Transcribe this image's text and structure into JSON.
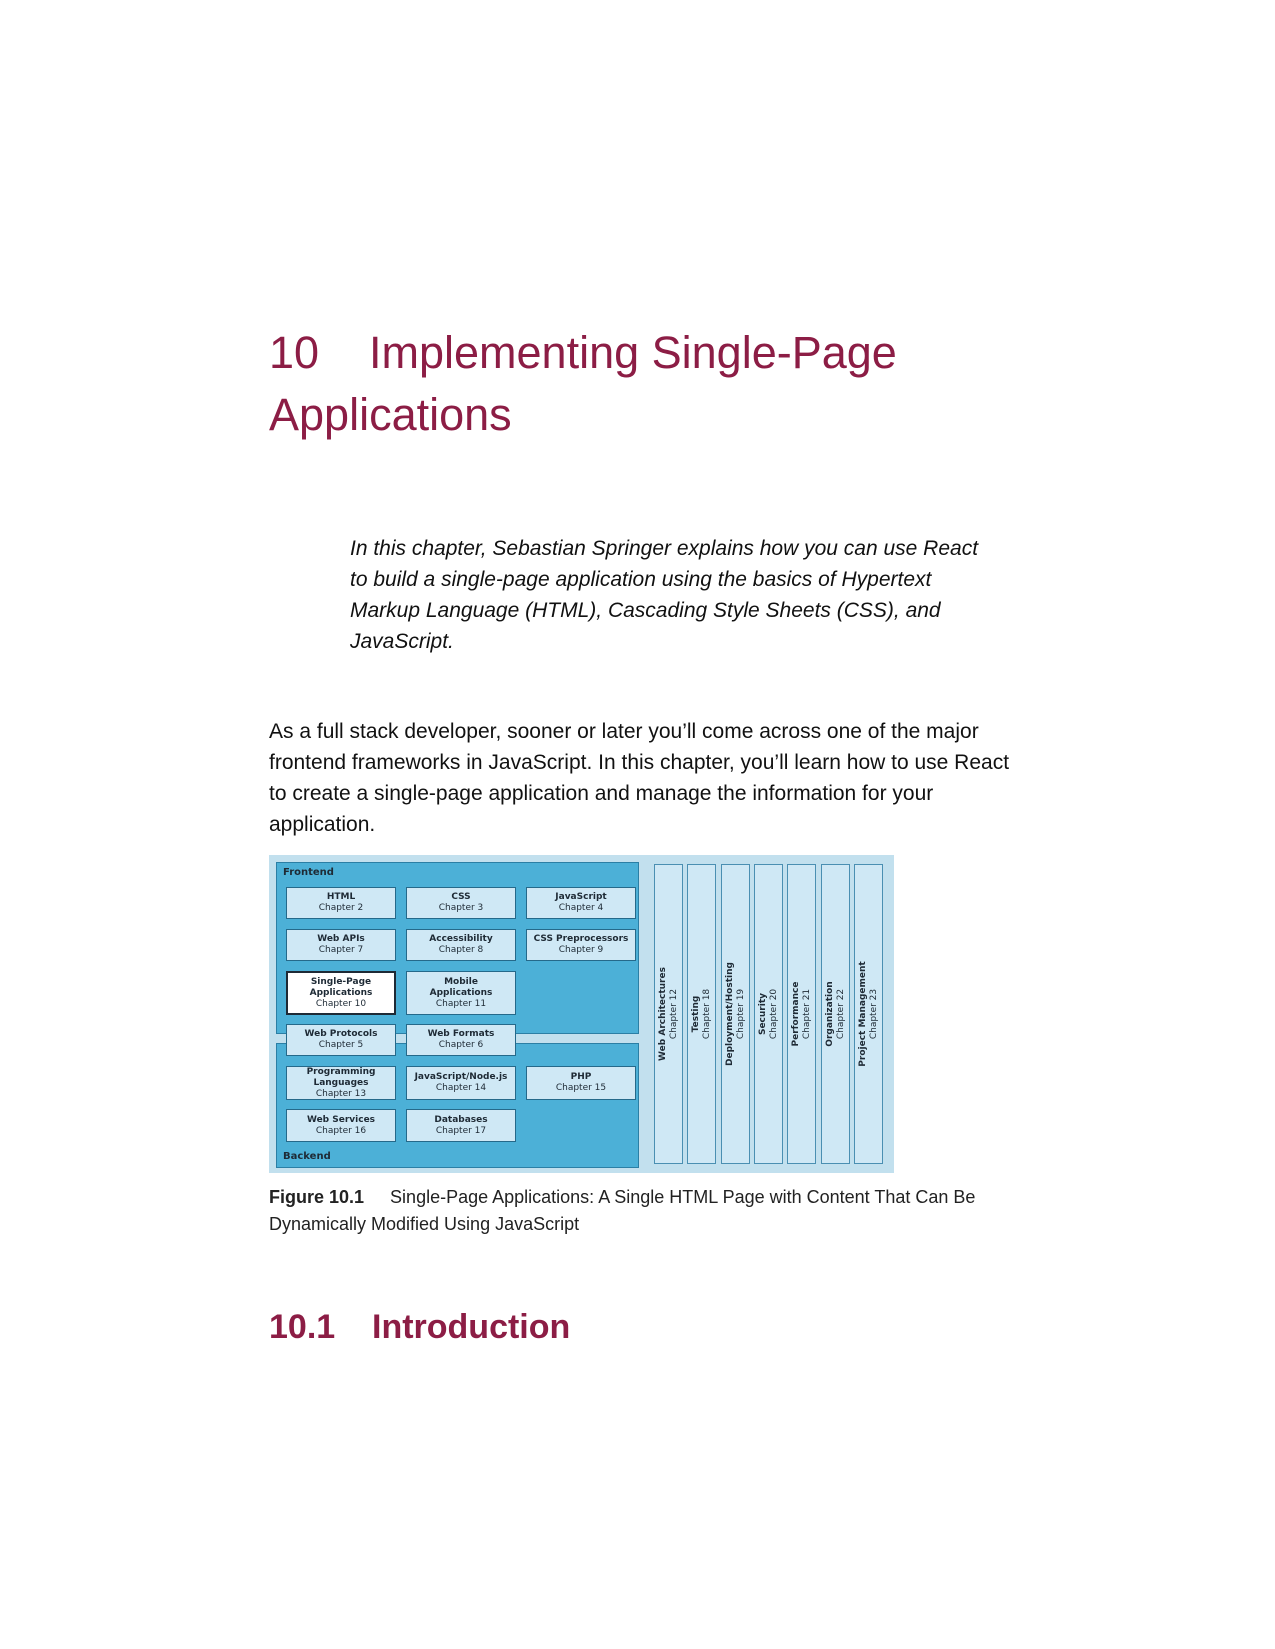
{
  "chapter": {
    "number": "10",
    "title": "Implementing Single-Page Applications"
  },
  "abstract": "In this chapter, Sebastian Springer explains how you can use React to build a single-page application using the basics of Hypertext Markup Language (HTML), Cascading Style Sheets (CSS), and JavaScript.",
  "body": "As a full stack developer, sooner or later you’ll come across one of the major frontend frameworks in JavaScript. In this chapter, you’ll learn how to use React to create a single-page application and manage the information for your application.",
  "figure": {
    "frontend_label": "Frontend",
    "backend_label": "Backend",
    "tiles": [
      {
        "title": "HTML",
        "chapter": "Chapter 2"
      },
      {
        "title": "CSS",
        "chapter": "Chapter 3"
      },
      {
        "title": "JavaScript",
        "chapter": "Chapter 4"
      },
      {
        "title": "Web APIs",
        "chapter": "Chapter 7"
      },
      {
        "title": "Accessibility",
        "chapter": "Chapter 8"
      },
      {
        "title": "CSS Preprocessors",
        "chapter": "Chapter 9"
      },
      {
        "title": "Single-Page",
        "title2": "Applications",
        "chapter": "Chapter 10"
      },
      {
        "title": "Mobile",
        "title2": "Applications",
        "chapter": "Chapter 11"
      },
      {
        "title": "Web Protocols",
        "chapter": "Chapter 5"
      },
      {
        "title": "Web Formats",
        "chapter": "Chapter 6"
      },
      {
        "title": "Programming Languages",
        "chapter": "Chapter 13"
      },
      {
        "title": "JavaScript/Node.js",
        "chapter": "Chapter 14"
      },
      {
        "title": "PHP",
        "chapter": "Chapter 15"
      },
      {
        "title": "Web Services",
        "chapter": "Chapter 16"
      },
      {
        "title": "Databases",
        "chapter": "Chapter 17"
      }
    ],
    "columns": [
      {
        "title": "Web Architectures",
        "chapter": "Chapter 12"
      },
      {
        "title": "Testing",
        "chapter": "Chapter 18"
      },
      {
        "title": "Deployment/Hosting",
        "chapter": "Chapter 19"
      },
      {
        "title": "Security",
        "chapter": "Chapter 20"
      },
      {
        "title": "Performance",
        "chapter": "Chapter 21"
      },
      {
        "title": "Organization",
        "chapter": "Chapter 22"
      },
      {
        "title": "Project Management",
        "chapter": "Chapter 23"
      }
    ],
    "colors": {
      "background": "#c2e0ee",
      "region": "#4cb0d7",
      "tile": "#cfe8f5",
      "highlight": "#ffffff"
    }
  },
  "caption": {
    "label": "Figure 10.1",
    "text": "Single-Page Applications: A Single HTML Page with Content That Can Be Dynamically Modified Using JavaScript"
  },
  "section": {
    "number": "10.1",
    "title": "Introduction"
  },
  "colors": {
    "heading": "#8c1d45"
  }
}
